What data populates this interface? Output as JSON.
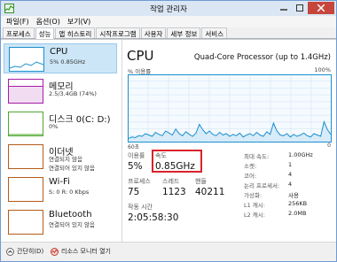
{
  "window": {
    "title": "작업 관리자"
  },
  "menu": [
    "파일(F)",
    "옵션(O)",
    "보기(V)"
  ],
  "tabs": [
    "프로세스",
    "성능",
    "앱 히스토리",
    "시작프로그램",
    "사용자",
    "세부 정보",
    "서비스"
  ],
  "active_tab": 1,
  "sidebar": [
    {
      "title": "CPU",
      "sub": "5% 0.85GHz",
      "sub2": "",
      "color": "#1b8fce"
    },
    {
      "title": "메모리",
      "sub": "2.5/3.4GB (74%)",
      "sub2": "",
      "color": "#a31ea7"
    },
    {
      "title": "디스크 0(C: D:)",
      "sub": "0%",
      "sub2": "",
      "color": "#4ea72e"
    },
    {
      "title": "이더넷",
      "sub": "연결되지 않음",
      "sub2": "연결되어 있지 않음",
      "color": "#b45b19"
    },
    {
      "title": "Wi-Fi",
      "sub": "S: 0 R: 0 Kbps",
      "sub2": "",
      "color": "#b45b19"
    },
    {
      "title": "Bluetooth",
      "sub": "연결되어 있지 않음",
      "sub2": "",
      "color": "#b45b19"
    }
  ],
  "main": {
    "title": "CPU",
    "model": "Quad-Core Processor (up to 1.4GHz)",
    "util_label": "% 이용률",
    "util_max": "100%",
    "time_left": "60초",
    "time_right": "0",
    "graph_color": "#1b8fce",
    "graph_values": [
      5,
      7,
      6,
      9,
      8,
      12,
      10,
      8,
      14,
      11,
      9,
      16,
      13,
      10,
      19,
      12,
      9,
      15,
      11,
      8,
      13,
      26,
      18,
      12,
      16,
      11,
      9,
      14,
      10,
      12,
      8,
      11,
      9,
      13,
      7,
      10,
      12,
      9,
      14,
      10,
      8,
      15,
      11,
      28,
      16,
      10,
      9,
      12,
      7,
      11,
      8,
      10,
      13,
      9,
      7,
      12,
      10,
      8,
      30,
      18,
      11
    ]
  },
  "stats": {
    "usage_label": "이용률",
    "usage": "5%",
    "speed_label": "속도",
    "speed": "0.85GHz",
    "processes_label": "프로세스",
    "processes": "75",
    "threads_label": "스레드",
    "threads": "1123",
    "handles_label": "핸들",
    "handles": "40211",
    "uptime_label": "작동 시간",
    "uptime": "2:05:58:30"
  },
  "specs": [
    {
      "label": "최대 속도:",
      "value": "1.00GHz"
    },
    {
      "label": "소켓:",
      "value": "1"
    },
    {
      "label": "코어:",
      "value": "4"
    },
    {
      "label": "논리 프로세서:",
      "value": "4"
    },
    {
      "label": "가상화:",
      "value": "사용"
    },
    {
      "label": "L1 캐시:",
      "value": "256KB"
    },
    {
      "label": "L2 캐시:",
      "value": "2.0MB"
    }
  ],
  "footer": {
    "details": "간단히(D)",
    "monitor": "리소스 모니터 열기"
  }
}
